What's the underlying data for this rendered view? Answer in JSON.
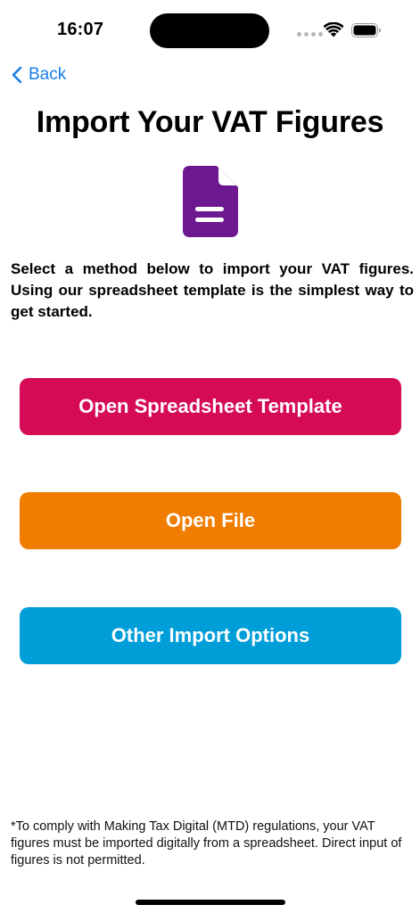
{
  "status_bar": {
    "time": "16:07",
    "icons": [
      "signal-dots-icon",
      "wifi-icon",
      "battery-icon"
    ]
  },
  "nav": {
    "back_label": "Back",
    "back_icon": "chevron-left-icon"
  },
  "header": {
    "title": "Import Your VAT Figures",
    "icon": "document-icon"
  },
  "intro": "Select a method below to import your VAT figures. Using our spreadsheet template is the simplest way to get started.",
  "actions": [
    {
      "label": "Open Spreadsheet Template",
      "color": "#d60b56"
    },
    {
      "label": "Open File",
      "color": "#f07c00"
    },
    {
      "label": "Other Import Options",
      "color": "#009ed9"
    }
  ],
  "footnote": "*To comply with Making Tax Digital (MTD) regulations, your VAT figures must be imported digitally from a spreadsheet. Direct input of figures is not permitted.",
  "colors": {
    "accent": "#1a7fe8",
    "document_icon": "#6c1891"
  }
}
